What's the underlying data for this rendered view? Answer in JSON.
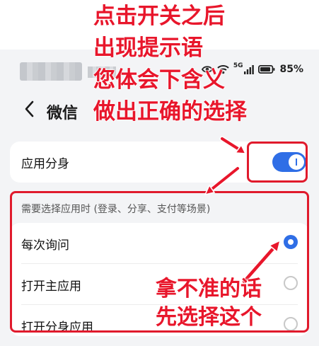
{
  "status_bar": {
    "battery_text": "85%",
    "network_label": "5G",
    "icons": [
      "eye-icon",
      "wifi-icon",
      "signal-icon",
      "battery-icon"
    ]
  },
  "header": {
    "title": "微信",
    "back_icon": "chevron-left-icon"
  },
  "clone_card": {
    "label": "应用分身",
    "toggle_state": "on"
  },
  "section": {
    "label": "需要选择应用时 (登录、分享、支付等场景)"
  },
  "options": [
    {
      "label": "每次询问",
      "selected": true
    },
    {
      "label": "打开主应用",
      "selected": false
    },
    {
      "label": "打开分身应用",
      "selected": false
    }
  ],
  "annotations": {
    "top_lines": [
      "点击开关之后",
      "出现提示语",
      "您体会下含义",
      "做出正确的选择"
    ],
    "bottom_lines": [
      "拿不准的话",
      "先选择这个"
    ]
  },
  "colors": {
    "accent": "#2f6ee6",
    "annotation": "#e8162b"
  }
}
